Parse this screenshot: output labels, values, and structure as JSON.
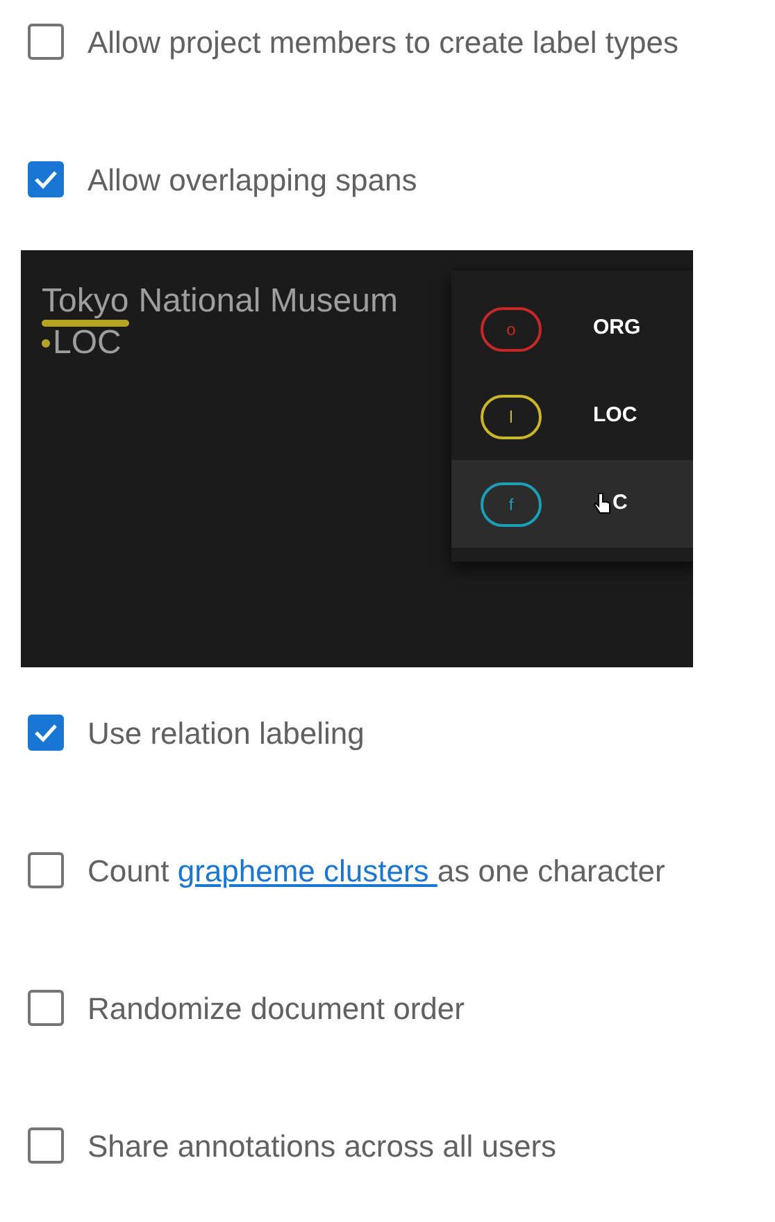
{
  "settings": [
    {
      "kind": "checkbox",
      "checked": false,
      "parts": [
        {
          "text": "Allow project members to create label types",
          "link": false
        }
      ]
    },
    {
      "kind": "checkbox",
      "checked": true,
      "parts": [
        {
          "text": "Allow overlapping spans",
          "link": false
        }
      ]
    },
    {
      "kind": "demo",
      "span_text": "Tokyo",
      "rest_text": "National Museum",
      "span_label": "LOC",
      "color": "#b5a322",
      "menu": [
        {
          "key": "o",
          "label": "ORG",
          "color": "#c62828",
          "selected": false
        },
        {
          "key": "l",
          "label": "LOC",
          "color": "#c9b62a",
          "selected": false
        },
        {
          "key": "f",
          "label": "C",
          "color": "#1a9fb5",
          "selected": true
        }
      ]
    },
    {
      "kind": "checkbox",
      "checked": true,
      "parts": [
        {
          "text": "Use relation labeling",
          "link": false
        }
      ]
    },
    {
      "kind": "checkbox",
      "checked": false,
      "parts": [
        {
          "text": "Count ",
          "link": false
        },
        {
          "text": "grapheme clusters ",
          "link": true
        },
        {
          "text": "as one character",
          "link": false
        }
      ]
    },
    {
      "kind": "checkbox",
      "checked": false,
      "parts": [
        {
          "text": "Randomize document order",
          "link": false
        }
      ]
    },
    {
      "kind": "checkbox",
      "checked": false,
      "parts": [
        {
          "text": "Share annotations across all users",
          "link": false
        }
      ]
    }
  ]
}
